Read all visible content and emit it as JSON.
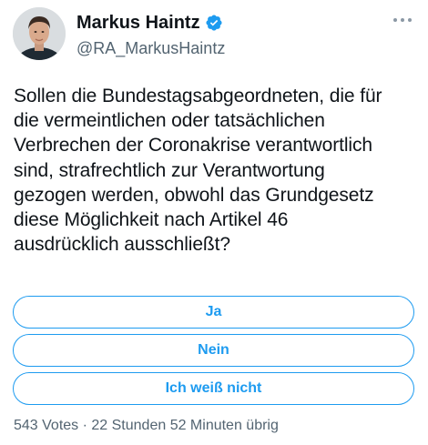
{
  "author": {
    "display_name": "Markus Haintz",
    "handle": "@RA_MarkusHaintz",
    "verified": true,
    "verified_color": "#1d9bf0"
  },
  "tweet": {
    "text": "Sollen die Bundestagsabgeordneten, die für\ndie vermeintlichen oder tatsächlichen\nVerbrechen der Coronakrise verantwortlich\nsind, strafrechtlich zur Verantwortung\ngezogen werden, obwohl das Grundgesetz\ndiese Möglichkeit nach Artikel 46\nausdrücklich ausschließt?"
  },
  "poll": {
    "options": [
      {
        "label": "Ja"
      },
      {
        "label": "Nein"
      },
      {
        "label": "Ich weiß nicht"
      }
    ],
    "meta": "543 Votes · 22 Stunden 52 Minuten übrig",
    "accent_color": "#1d9bf0"
  },
  "icons": {
    "more": "more-horizontal-icon",
    "verified": "verified-badge-icon"
  }
}
